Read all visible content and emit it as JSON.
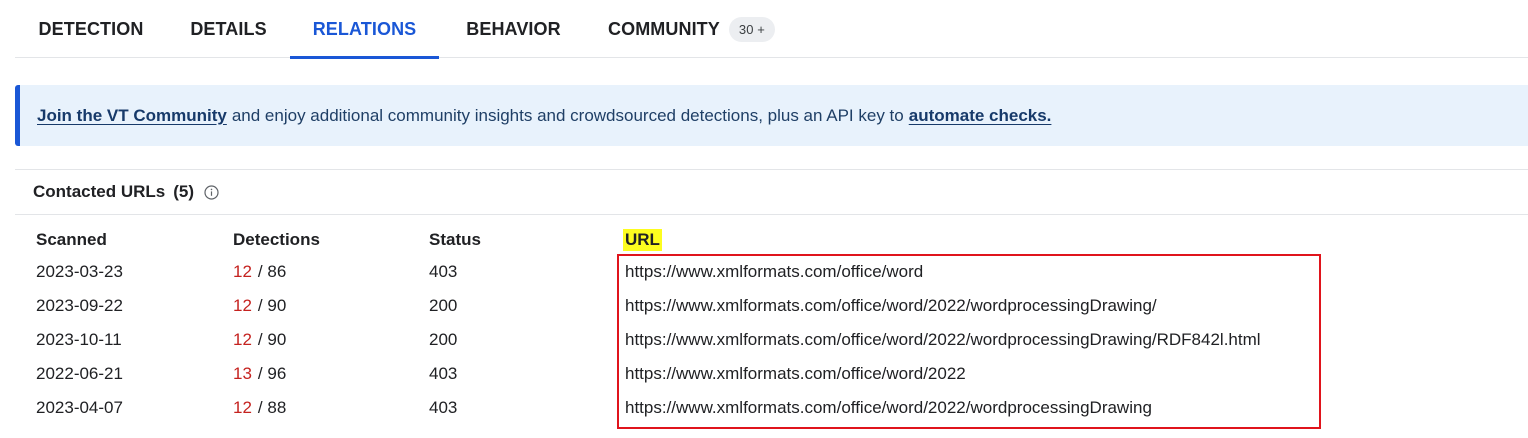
{
  "tabs": {
    "detection": "DETECTION",
    "details": "DETAILS",
    "relations": "RELATIONS",
    "behavior": "BEHAVIOR",
    "community": "COMMUNITY",
    "community_badge": "30 +"
  },
  "banner": {
    "join_link": "Join the VT Community",
    "middle_text": "and enjoy additional community insights and crowdsourced detections, plus an API key to",
    "automate_link": "automate checks."
  },
  "section": {
    "title": "Contacted URLs",
    "count": "(5)",
    "info_icon": "info-circle-icon"
  },
  "table": {
    "headers": {
      "scanned": "Scanned",
      "detections": "Detections",
      "status": "Status",
      "url": "URL"
    },
    "rows": [
      {
        "scanned": "2023-03-23",
        "det_hits": "12",
        "det_total": "/ 86",
        "status": "403",
        "url": "https://www.xmlformats.com/office/word"
      },
      {
        "scanned": "2023-09-22",
        "det_hits": "12",
        "det_total": "/ 90",
        "status": "200",
        "url": "https://www.xmlformats.com/office/word/2022/wordprocessingDrawing/"
      },
      {
        "scanned": "2023-10-11",
        "det_hits": "12",
        "det_total": "/ 90",
        "status": "200",
        "url": "https://www.xmlformats.com/office/word/2022/wordprocessingDrawing/RDF842l.html"
      },
      {
        "scanned": "2022-06-21",
        "det_hits": "13",
        "det_total": "/ 96",
        "status": "403",
        "url": "https://www.xmlformats.com/office/word/2022"
      },
      {
        "scanned": "2023-04-07",
        "det_hits": "12",
        "det_total": "/ 88",
        "status": "403",
        "url": "https://www.xmlformats.com/office/word/2022/wordprocessingDrawing"
      }
    ]
  },
  "colors": {
    "accent": "#1a57d6",
    "detection_red": "#c5221f",
    "highlight_yellow": "#fdfd1f",
    "annotation_box": "#e0141c",
    "banner_bg": "#e8f2fc"
  }
}
